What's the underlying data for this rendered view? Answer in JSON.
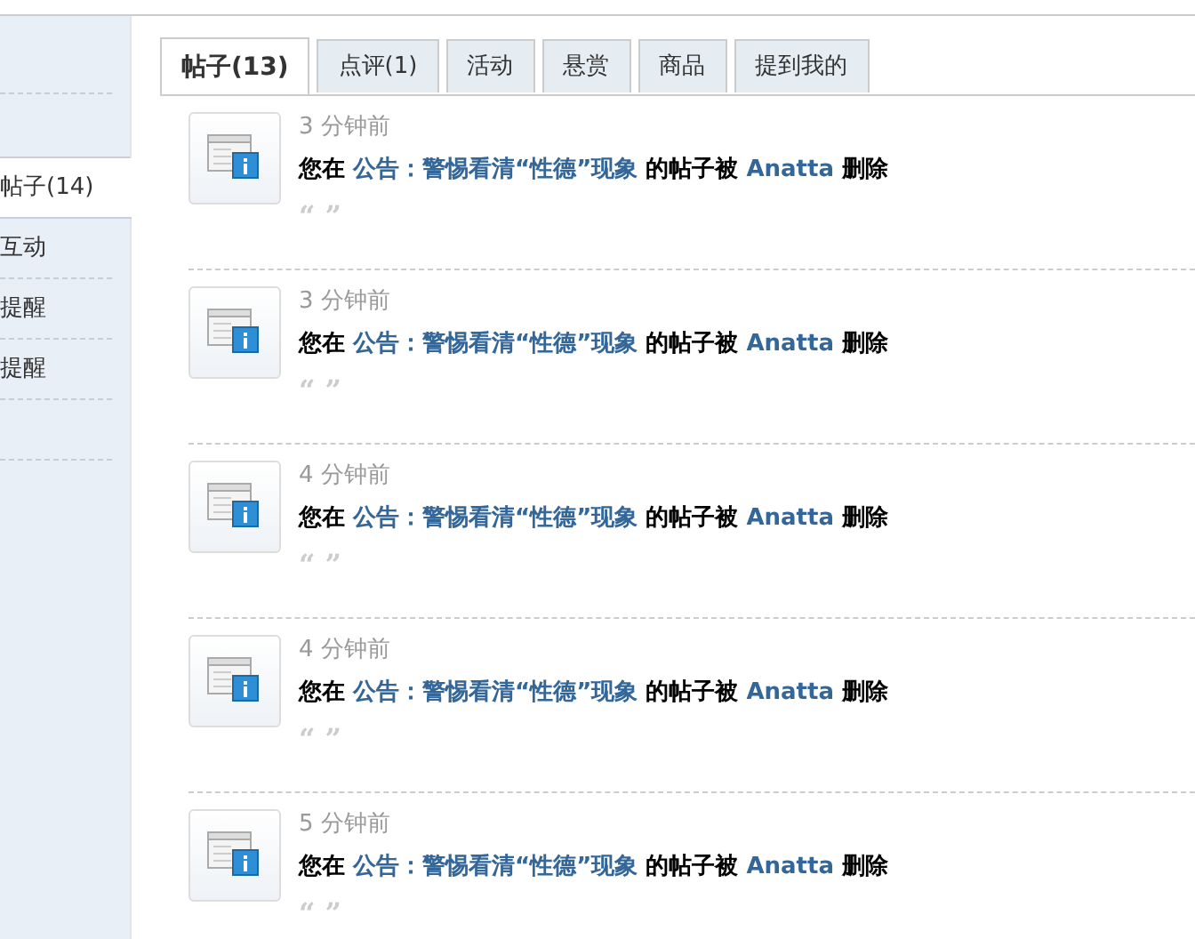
{
  "sidebar": {
    "items": [
      {
        "label": "帖子(14)",
        "selected": true
      },
      {
        "label": "互动",
        "selected": false
      },
      {
        "label": "提醒",
        "selected": false
      },
      {
        "label": "提醒",
        "selected": false
      }
    ]
  },
  "tabs": [
    {
      "label": "帖子(13)",
      "selected": true
    },
    {
      "label": "点评(1)",
      "selected": false
    },
    {
      "label": "活动",
      "selected": false
    },
    {
      "label": "悬赏",
      "selected": false
    },
    {
      "label": "商品",
      "selected": false
    },
    {
      "label": "提到我的",
      "selected": false
    }
  ],
  "notices": [
    {
      "time": "3 分钟前",
      "prefix": "您在",
      "thread": "公告：警惕看清“性德”现象",
      "middle": "的帖子被",
      "user": "Anatta",
      "action": "删除",
      "quote": "“ ”"
    },
    {
      "time": "3 分钟前",
      "prefix": "您在",
      "thread": "公告：警惕看清“性德”现象",
      "middle": "的帖子被",
      "user": "Anatta",
      "action": "删除",
      "quote": "“ ”"
    },
    {
      "time": "4 分钟前",
      "prefix": "您在",
      "thread": "公告：警惕看清“性德”现象",
      "middle": "的帖子被",
      "user": "Anatta",
      "action": "删除",
      "quote": "“ ”"
    },
    {
      "time": "4 分钟前",
      "prefix": "您在",
      "thread": "公告：警惕看清“性德”现象",
      "middle": "的帖子被",
      "user": "Anatta",
      "action": "删除",
      "quote": "“ ”"
    },
    {
      "time": "5 分钟前",
      "prefix": "您在",
      "thread": "公告：警惕看清“性德”现象",
      "middle": "的帖子被",
      "user": "Anatta",
      "action": "删除",
      "quote": "“ ”"
    }
  ]
}
